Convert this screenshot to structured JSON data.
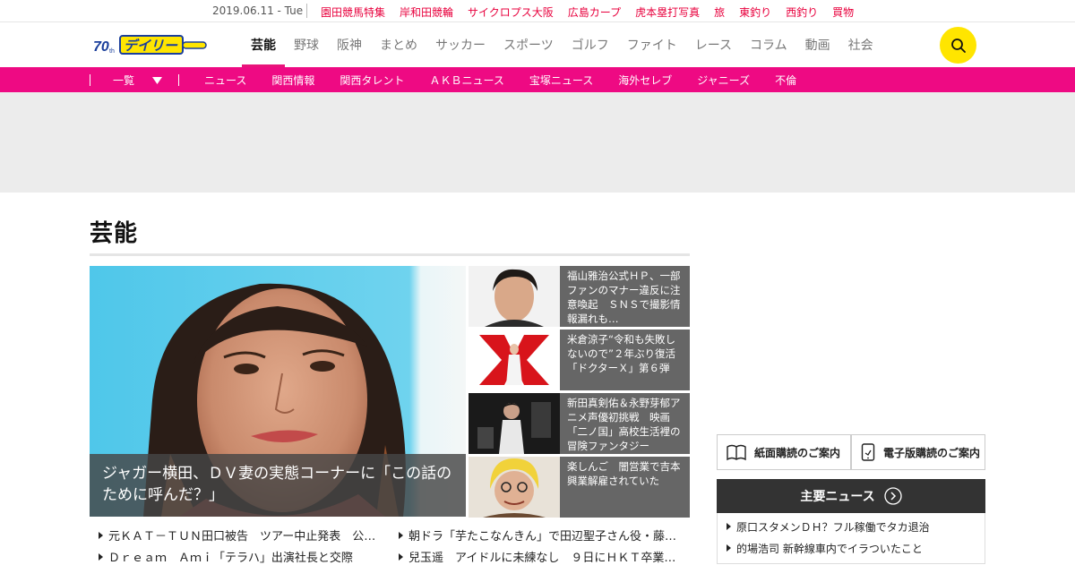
{
  "topbar": {
    "date": "2019.06.11 - Tue",
    "links": [
      "園田競馬特集",
      "岸和田競輪",
      "サイクロプス大阪",
      "広島カープ",
      "虎本塁打写真",
      "旅",
      "東釣り",
      "西釣り",
      "買物"
    ]
  },
  "header": {
    "logo_text": "デイリー",
    "logo_badge": "70th",
    "nav": [
      "芸能",
      "野球",
      "阪神",
      "まとめ",
      "サッカー",
      "スポーツ",
      "ゴルフ",
      "ファイト",
      "レース",
      "コラム",
      "動画",
      "社会"
    ],
    "active_nav": "芸能"
  },
  "subnav": {
    "all_label": "一覧",
    "links": [
      "ニュース",
      "関西情報",
      "関西タレント",
      "ＡＫＢニュース",
      "宝塚ニュース",
      "海外セレブ",
      "ジャニーズ",
      "不倫"
    ]
  },
  "section": {
    "title": "芸能"
  },
  "feature": {
    "caption": "ジャガー横田、ＤＶ妻の実態コーナーに「この話のために呼んだ？」"
  },
  "side_news": [
    {
      "text": "福山雅治公式ＨＰ、一部ファンのマナー違反に注意喚起　ＳＮＳで撮影情報漏れも…"
    },
    {
      "text": "米倉涼子“令和も失敗しないので”２年ぶり復活「ドクターＸ」第６弾"
    },
    {
      "text": "新田真剣佑＆永野芽郁アニメ声優初挑戦　映画「二ノ国」高校生活裡の冒険ファンタジー"
    },
    {
      "text": "楽しんご　闇営業で吉本興業解雇されていた"
    }
  ],
  "headlines": [
    "元ＫＡＴ－ＴＵＮ田口被告　ツアー中止発表　公…",
    "朝ドラ「芋たこなんきん」で田辺聖子さん役・藤…",
    "Ｄｒｅａｍ　Ａｍｉ「テラハ」出演社長と交際",
    "兒玉遥　アイドルに未練なし　９日にＨＫＴ卒業…"
  ],
  "right_column": {
    "print_subscription": "紙面購読のご案内",
    "digital_subscription": "電子版購読のご案内",
    "major_news_title": "主要ニュース",
    "major_news": [
      "原口スタメンＤＨ？フル稼働でタカ退治",
      "的場浩司 新幹線車内でイラついたこと"
    ]
  },
  "colors": {
    "brand_pink": "#ee0a83",
    "link_red": "#e8003d",
    "search_yellow": "#ffe500"
  }
}
